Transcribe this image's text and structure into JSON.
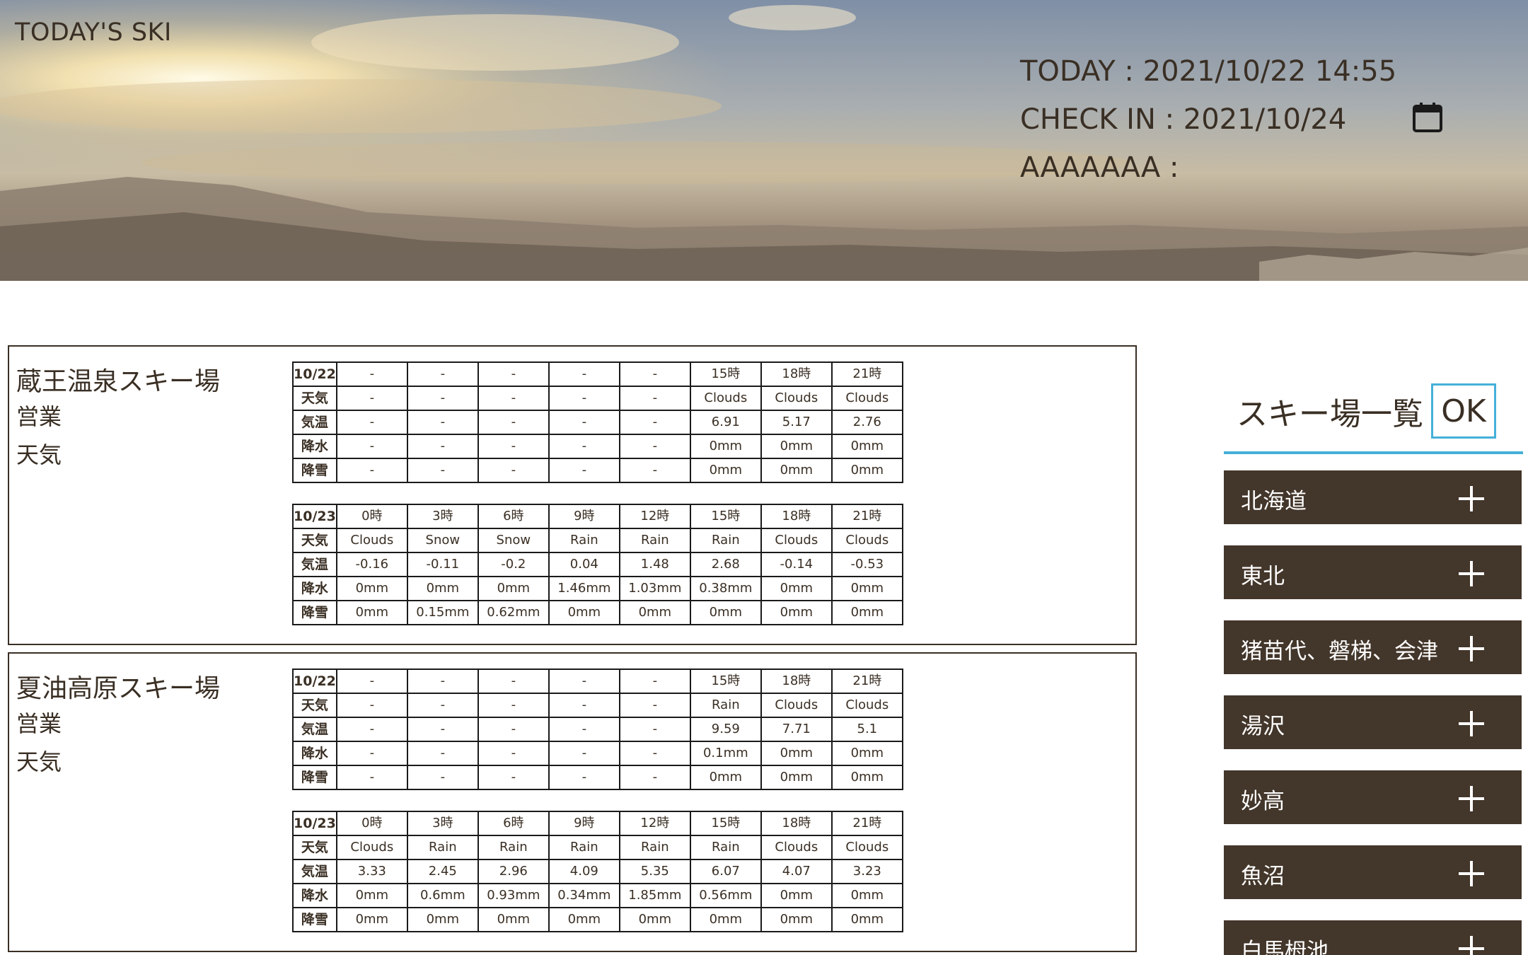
{
  "header": {
    "brand": "TODAY'S SKI",
    "today": "TODAY : 2021/10/22 14:55",
    "checkin": "CHECK IN : 2021/10/24",
    "extra": "AAAAAAA :",
    "calendar_icon": "calendar-icon"
  },
  "resorts": [
    {
      "name": "蔵王温泉スキー場",
      "status_label": "営業",
      "weather_label": "天気",
      "days": [
        {
          "rows": [
            [
              "10/22",
              "-",
              "-",
              "-",
              "-",
              "-",
              "15時",
              "18時",
              "21時"
            ],
            [
              "天気",
              "-",
              "-",
              "-",
              "-",
              "-",
              "Clouds",
              "Clouds",
              "Clouds"
            ],
            [
              "気温",
              "-",
              "-",
              "-",
              "-",
              "-",
              "6.91",
              "5.17",
              "2.76"
            ],
            [
              "降水",
              "-",
              "-",
              "-",
              "-",
              "-",
              "0mm",
              "0mm",
              "0mm"
            ],
            [
              "降雪",
              "-",
              "-",
              "-",
              "-",
              "-",
              "0mm",
              "0mm",
              "0mm"
            ]
          ]
        },
        {
          "rows": [
            [
              "10/23",
              "0時",
              "3時",
              "6時",
              "9時",
              "12時",
              "15時",
              "18時",
              "21時"
            ],
            [
              "天気",
              "Clouds",
              "Snow",
              "Snow",
              "Rain",
              "Rain",
              "Rain",
              "Clouds",
              "Clouds"
            ],
            [
              "気温",
              "-0.16",
              "-0.11",
              "-0.2",
              "0.04",
              "1.48",
              "2.68",
              "-0.14",
              "-0.53"
            ],
            [
              "降水",
              "0mm",
              "0mm",
              "0mm",
              "1.46mm",
              "1.03mm",
              "0.38mm",
              "0mm",
              "0mm"
            ],
            [
              "降雪",
              "0mm",
              "0.15mm",
              "0.62mm",
              "0mm",
              "0mm",
              "0mm",
              "0mm",
              "0mm"
            ]
          ]
        }
      ]
    },
    {
      "name": "夏油高原スキー場",
      "status_label": "営業",
      "weather_label": "天気",
      "days": [
        {
          "rows": [
            [
              "10/22",
              "-",
              "-",
              "-",
              "-",
              "-",
              "15時",
              "18時",
              "21時"
            ],
            [
              "天気",
              "-",
              "-",
              "-",
              "-",
              "-",
              "Rain",
              "Clouds",
              "Clouds"
            ],
            [
              "気温",
              "-",
              "-",
              "-",
              "-",
              "-",
              "9.59",
              "7.71",
              "5.1"
            ],
            [
              "降水",
              "-",
              "-",
              "-",
              "-",
              "-",
              "0.1mm",
              "0mm",
              "0mm"
            ],
            [
              "降雪",
              "-",
              "-",
              "-",
              "-",
              "-",
              "0mm",
              "0mm",
              "0mm"
            ]
          ]
        },
        {
          "rows": [
            [
              "10/23",
              "0時",
              "3時",
              "6時",
              "9時",
              "12時",
              "15時",
              "18時",
              "21時"
            ],
            [
              "天気",
              "Clouds",
              "Rain",
              "Rain",
              "Rain",
              "Rain",
              "Rain",
              "Clouds",
              "Clouds"
            ],
            [
              "気温",
              "3.33",
              "2.45",
              "2.96",
              "4.09",
              "5.35",
              "6.07",
              "4.07",
              "3.23"
            ],
            [
              "降水",
              "0mm",
              "0.6mm",
              "0.93mm",
              "0.34mm",
              "1.85mm",
              "0.56mm",
              "0mm",
              "0mm"
            ],
            [
              "降雪",
              "0mm",
              "0mm",
              "0mm",
              "0mm",
              "0mm",
              "0mm",
              "0mm",
              "0mm"
            ]
          ]
        }
      ]
    }
  ],
  "panel": {
    "title": "スキー場一覧",
    "ok_label": "OK",
    "regions": [
      "北海道",
      "東北",
      "猪苗代、磐梯、会津",
      "湯沢",
      "妙高",
      "魚沼",
      "白馬栂池"
    ],
    "expand_icon": "plus-icon"
  },
  "colors": {
    "text": "#3a2f24",
    "region_bg": "#43362a",
    "accent": "#45b0d8"
  }
}
